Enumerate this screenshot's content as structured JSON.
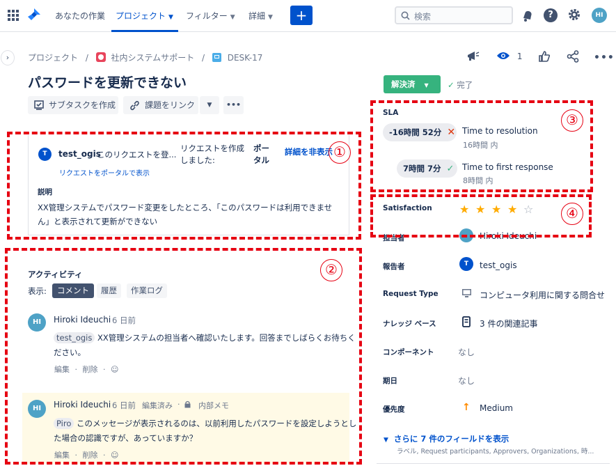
{
  "nav": {
    "your_work": "あなたの作業",
    "projects": "プロジェクト",
    "filters": "フィルター",
    "details": "詳細",
    "create": "+",
    "search_placeholder": "検索",
    "user_initials": "HI"
  },
  "breadcrumb": {
    "projects": "プロジェクト",
    "sep": "/",
    "project": "社内システムサポート",
    "issue_key": "DESK-17"
  },
  "watchers_count": "1",
  "issue": {
    "title": "パスワードを更新できない",
    "subtask_btn": "サブタスクを作成",
    "link_btn": "課題をリンク",
    "more": "•••"
  },
  "request": {
    "avatar": "T",
    "reporter": "test_ogis",
    "raised_text": "このリクエストを登...",
    "via_label": "リクエストを作成しました:",
    "via_value": "ポータル",
    "hide_details": "詳細を非表示",
    "view_portal": "リクエストをポータルで表示",
    "desc_label": "説明",
    "desc_line1": "XX管理システムでパスワード変更をしたところ、「このパスワードは利用できませ",
    "desc_line2": "ん」と表示されて更新ができない"
  },
  "activity": {
    "title": "アクティビティ",
    "show": "表示:",
    "tabs": [
      "コメント",
      "履歴",
      "作業ログ"
    ],
    "comments": [
      {
        "initials": "HI",
        "author": "Hiroki Ideuchi",
        "time": "6 日前",
        "mention": "test_ogis",
        "line1": "XX管理システムの担当者へ確認いたします。回答までしばらくお待ちく",
        "line2": "ださい。",
        "edit": "編集",
        "delete": "削除",
        "dot": "·"
      },
      {
        "initials": "HI",
        "author": "Hiroki Ideuchi",
        "time": "6 日前",
        "edited": "編集済み",
        "internal": "内部メモ",
        "mention": "Piro",
        "line1": "このメッセージが表示されるのは、以前利用したパスワードを設定しようとし",
        "line2": "た場合の認識ですが、あっていますか？",
        "edit": "編集",
        "delete": "削除",
        "dot": "·"
      }
    ]
  },
  "status": {
    "label": "解決済",
    "done": "完了"
  },
  "sla": {
    "title": "SLA",
    "items": [
      {
        "time": "-16時間 52分",
        "name": "Time to resolution",
        "sub": "16時間 内"
      },
      {
        "time": "7時間 7分",
        "name": "Time to first response",
        "sub": "8時間 内"
      }
    ]
  },
  "fields": {
    "satisfaction_label": "Satisfaction",
    "rating": 4,
    "rating_max": 5,
    "assignee_label": "担当者",
    "assignee": "Hiroki Ideuchi",
    "reporter_label": "報告者",
    "reporter": "test_ogis",
    "reporter_initial": "T",
    "request_type_label": "Request Type",
    "request_type": "コンピュータ利用に関する問合せ",
    "knowledge_label": "ナレッジ ベース",
    "knowledge": "3 件の関連記事",
    "component_label": "コンポーネント",
    "component": "なし",
    "due_label": "期日",
    "due": "なし",
    "priority_label": "優先度",
    "priority": "Medium",
    "more_fields": "さらに 7 件のフィールドを表示",
    "more_fields_sub": "ラベル, Request participants, Approvers, Organizations, 時..."
  },
  "annotations": [
    "①",
    "②",
    "③",
    "④"
  ],
  "colors": {
    "primary": "#0052cc",
    "success": "#36b37e",
    "status_done": "#36b37e",
    "danger": "#e60012",
    "internal_note_bg": "#fffae6"
  }
}
